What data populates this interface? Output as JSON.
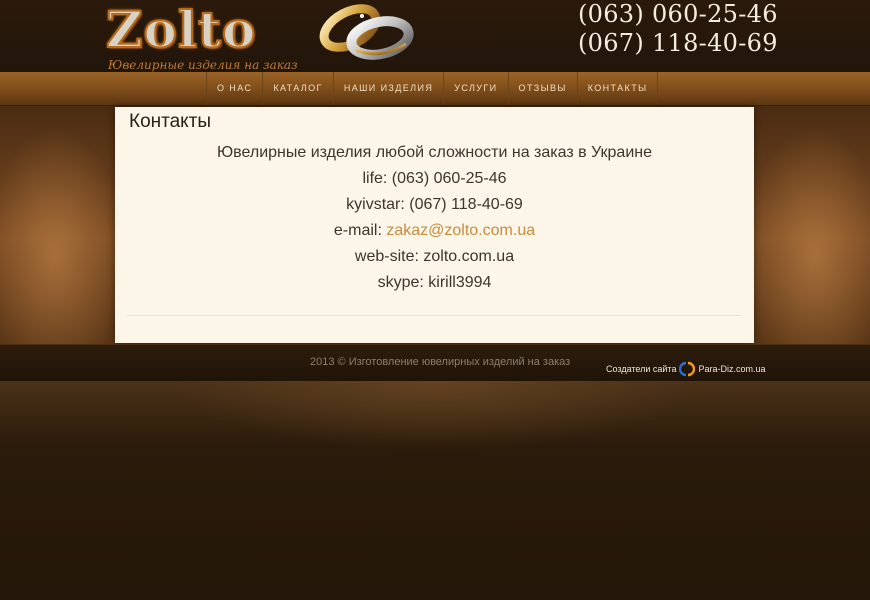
{
  "header": {
    "logo_text": "Zolto",
    "tagline": "Ювелирные изделия на заказ",
    "phones": [
      "(063) 060-25-46",
      "(067) 118-40-69"
    ]
  },
  "nav": {
    "items": [
      "О НАС",
      "КАТАЛОГ",
      "НАШИ ИЗДЕЛИЯ",
      "УСЛУГИ",
      "ОТЗЫВЫ",
      "КОНТАКТЫ"
    ]
  },
  "content": {
    "title": "Контакты",
    "headline": "Ювелирные изделия любой сложности на заказ в Украине",
    "life": "life: (063) 060-25-46",
    "kyivstar": "kyivstar: (067) 118-40-69",
    "email_label": "e-mail:",
    "email": "zakaz@zolto.com.ua",
    "website": "web-site: zolto.com.ua",
    "skype": "skype: kirill3994"
  },
  "footer": {
    "copyright": "2013 © Изготовление ювелирных изделий на заказ",
    "credits_label": "Создатели сайта",
    "credits_site": "Para-Diz.com.ua"
  },
  "colors": {
    "accent": "#c98a3e",
    "nav_bg": "#83501c",
    "panel_bg": "#fbf6e8"
  }
}
